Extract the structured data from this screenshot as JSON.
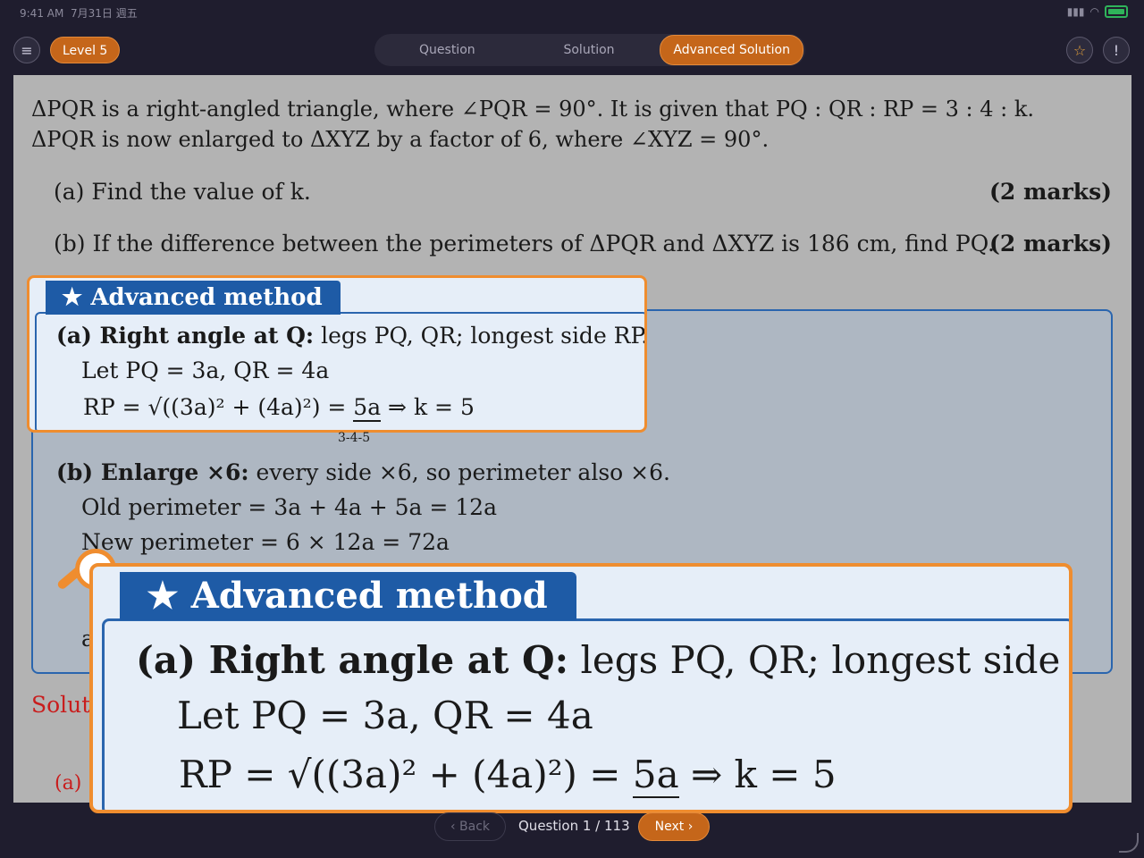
{
  "status": {
    "time": "9:41 AM",
    "date": "7月31日 週五"
  },
  "header": {
    "level": "Level 5",
    "tabs": [
      "Question",
      "Solution",
      "Advanced Solution"
    ],
    "active_tab": "Advanced Solution"
  },
  "question": {
    "line1": "ΔPQR is a right-angled triangle, where ∠PQR = 90°. It is given that PQ : QR : RP = 3 : 4 : k.",
    "line2": "ΔPQR is now enlarged to ΔXYZ by a factor of 6, where ∠XYZ = 90°.",
    "part_a": "(a)  Find the value of k.",
    "part_a_marks": "(2 marks)",
    "part_b": "(b)  If the difference between the perimeters of ΔPQR and ΔXYZ is 186 cm, find PQ.",
    "part_b_marks": "(2 marks)"
  },
  "advanced": {
    "header": "★  Advanced method",
    "a_title": "(a) Right angle at Q:",
    "a_rest": " legs PQ, QR; longest side RP.",
    "a_let": "Let PQ = 3a, QR = 4a",
    "a_rp_left": "RP = √((3a)² + (4a)²) = ",
    "a_rp_val": "5a",
    "a_rp_right": "  ⇒  k = 5",
    "a_note": "3-4-5",
    "b_title": "(b) Enlarge ×6:",
    "b_rest": " every side ×6, so perimeter also ×6.",
    "b_old": "Old perimeter = 3a + 4a + 5a = 12a",
    "b_new": "New perimeter = 6 × 12a = 72a",
    "cut_letter": "a"
  },
  "solution_label": "Soluti",
  "solution_cut": "(a)",
  "nav": {
    "back": "Back",
    "count": "Question 1 / 113",
    "next": "Next"
  }
}
